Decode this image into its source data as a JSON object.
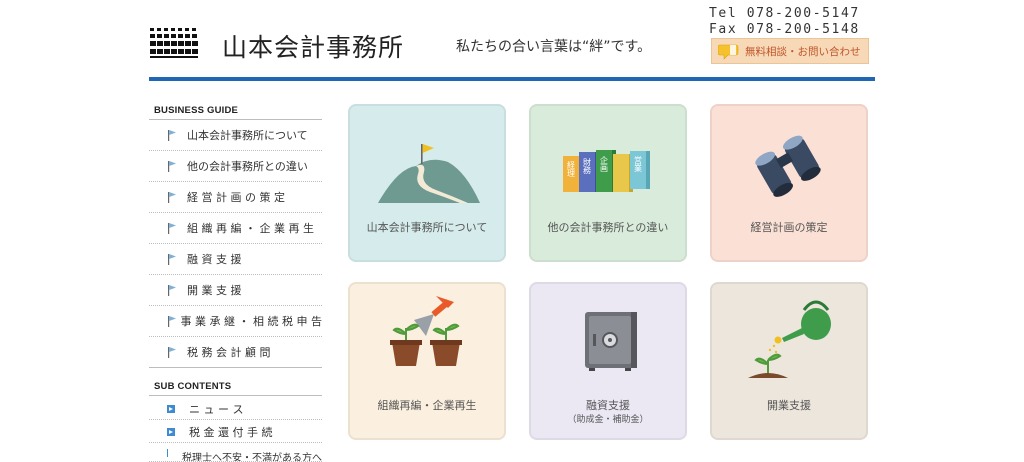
{
  "header": {
    "brand_name": "山本会計事務所",
    "tagline": "私たちの合い言葉は“絆”です。",
    "tel": "Tel 078-200-5147",
    "fax": "Fax 078-200-5148",
    "contact_button_label": "無料相談・お問い合わせ"
  },
  "colors": {
    "accent_blue": "#1f67b3",
    "contact_bg": "#f7d9b8",
    "contact_text": "#c0552a",
    "tile_teal": "#d6ecec",
    "tile_green": "#d9ecdb",
    "tile_pink": "#fbe0d5",
    "tile_cream": "#fbefdf",
    "tile_lavender": "#ebe8f4",
    "tile_beige": "#ede6dc"
  },
  "sidebar": {
    "business_heading": "BUSINESS GUIDE",
    "business_items": [
      "山本会計事務所について",
      "他の会計事務所との違い",
      "経 営 計 画 の 策 定",
      "組 織 再 編 ・ 企 業 再 生",
      "融 資 支 援",
      "開 業 支 援",
      "事 業 承 継 ・ 相 続 税 申 告",
      "税 務 会 計 顧 問"
    ],
    "sub_heading": "SUB CONTENTS",
    "sub_items": [
      "ニ ュ ー ス",
      "税 金 還 付 手 続",
      "税理士へ不安・不満がある方へ"
    ]
  },
  "tiles": [
    {
      "label": "山本会計事務所について",
      "icon": "flag-mountain-icon"
    },
    {
      "label": "他の会計事務所との違い",
      "icon": "books-icon",
      "book_labels": [
        "経理",
        "財務",
        "企画",
        "営業"
      ]
    },
    {
      "label": "経営計画の策定",
      "icon": "binoculars-icon"
    },
    {
      "label": "組織再編・企業再生",
      "icon": "trowel-plants-icon"
    },
    {
      "label": "融資支援",
      "sublabel": "（助成金・補助金）",
      "icon": "safe-icon"
    },
    {
      "label": "開業支援",
      "icon": "watering-can-sprout-icon"
    }
  ]
}
